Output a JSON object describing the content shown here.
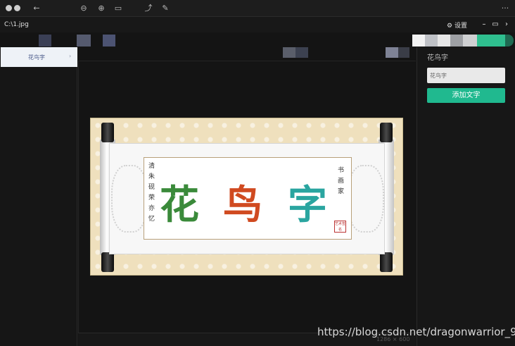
{
  "header": {
    "filename": "C:\\1.jpg",
    "settings_label": "设置",
    "more_label": "···"
  },
  "sidebar": {
    "items": [
      {
        "label": "花鸟字",
        "arrow": "›"
      }
    ]
  },
  "painting": {
    "left_column": "清朱砚荣亦忆",
    "right_column": "书画家",
    "big_chars": [
      "花",
      "鸟",
      "字"
    ],
    "stamp": "艺术签名"
  },
  "status": {
    "size_text": "1286 × 600"
  },
  "right_panel": {
    "title": "花鸟字",
    "input_value": "花鸟字",
    "add_button": "添加文字"
  },
  "watermark": "https://blog.csdn.net/dragonwarrior_95",
  "colors": {
    "accent": "#20b98f",
    "background": "#141414"
  },
  "icons": [
    "close-icon",
    "minimize-icon",
    "back-icon",
    "zoom-out-icon",
    "zoom-in-icon",
    "fit-icon",
    "rotate-icon",
    "tool-icon",
    "gear-icon",
    "window-minimize-icon",
    "window-maximize-icon",
    "window-close-icon"
  ]
}
